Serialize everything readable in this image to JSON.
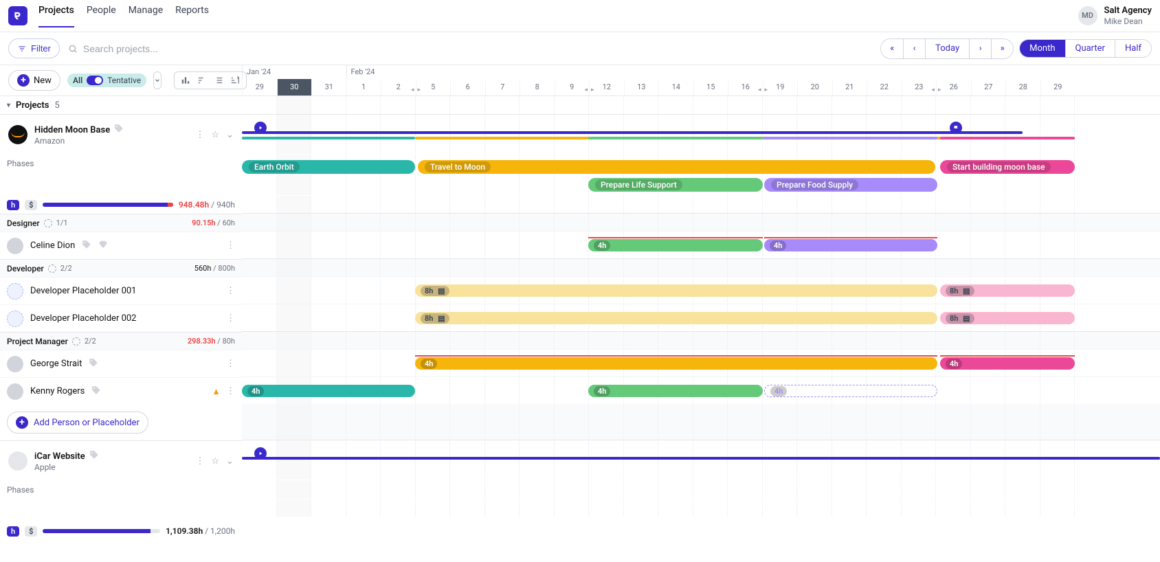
{
  "nav": {
    "items": [
      "Projects",
      "People",
      "Manage",
      "Reports"
    ],
    "activeIndex": 0
  },
  "user": {
    "initials": "MD",
    "agency": "Salt Agency",
    "name": "Mike Dean"
  },
  "toolbar": {
    "filter": "Filter",
    "searchPlaceholder": "Search projects...",
    "today": "Today",
    "views": [
      "Month",
      "Quarter",
      "Half"
    ],
    "activeViewIndex": 0
  },
  "subtoolbar": {
    "new": "New",
    "all": "All",
    "tentative": "Tentative"
  },
  "timeline": {
    "months": [
      {
        "label": "Jan '24",
        "span": 3
      },
      {
        "label": "Feb '24",
        "span": 21
      }
    ],
    "days": [
      "29",
      "30",
      "31",
      "1",
      "2",
      "5",
      "6",
      "7",
      "8",
      "9",
      "12",
      "13",
      "14",
      "15",
      "16",
      "19",
      "20",
      "21",
      "22",
      "23",
      "26",
      "27",
      "28",
      "29"
    ],
    "todayIndex": 1,
    "weekends": [
      4,
      9,
      14,
      19
    ]
  },
  "projectsHeader": {
    "label": "Projects",
    "count": "5"
  },
  "projects": [
    {
      "name": "Hidden Moon Base",
      "client": "Amazon",
      "avatarClass": "amazon",
      "phasesLabel": "Phases",
      "budget": {
        "used": "948.48h",
        "total": "940h",
        "percent": 100,
        "over": true
      },
      "summaries": [
        {
          "start": 0,
          "end": 252,
          "color": "#2ab7a9"
        },
        {
          "start": 252,
          "end": 1212,
          "color": "#f5b50a"
        },
        {
          "start": 504,
          "end": 758,
          "color": "#65c97a"
        },
        {
          "start": 758,
          "end": 1012,
          "color": "#a78bfa"
        },
        {
          "start": 1016,
          "end": 1212,
          "color": "#ec4899"
        }
      ],
      "phases": [
        {
          "row": 0,
          "start": 0,
          "end": 252,
          "color": "#2ab7a9",
          "label": "Earth Orbit"
        },
        {
          "row": 0,
          "start": 256,
          "end": 1009,
          "color": "#f5b50a",
          "label": "Travel to Moon"
        },
        {
          "row": 0,
          "start": 1016,
          "end": 1212,
          "color": "#ec4899",
          "label": "Start building moon base"
        },
        {
          "row": 1,
          "start": 504,
          "end": 758,
          "color": "#65c97a",
          "label": "Prepare Life Support"
        },
        {
          "row": 1,
          "start": 760,
          "end": 1012,
          "color": "#a78bfa",
          "label": "Prepare Food Supply"
        }
      ],
      "roles": [
        {
          "name": "Designer",
          "count": "1/1",
          "budget": {
            "used": "90.15h",
            "total": "60h",
            "over": true
          },
          "people": [
            {
              "name": "Celine Dion",
              "icons": [
                "tag",
                "diamond"
              ],
              "allocs": [
                {
                  "start": 504,
                  "end": 758,
                  "color": "#65c97a",
                  "label": "4h",
                  "overline": true
                },
                {
                  "start": 760,
                  "end": 1012,
                  "color": "#a78bfa",
                  "label": "4h",
                  "overline": true
                }
              ]
            }
          ]
        },
        {
          "name": "Developer",
          "count": "2/2",
          "budget": {
            "used": "560h",
            "total": "800h",
            "over": false
          },
          "people": [
            {
              "name": "Developer Placeholder 001",
              "placeholder": true,
              "allocs": [
                {
                  "start": 252,
                  "end": 1012,
                  "color": "#f9e29c",
                  "label": "8h",
                  "note": true,
                  "textDark": true
                },
                {
                  "start": 1016,
                  "end": 1212,
                  "color": "#f9b6d0",
                  "label": "8h",
                  "note": true,
                  "textDark": true
                }
              ]
            },
            {
              "name": "Developer Placeholder 002",
              "placeholder": true,
              "allocs": [
                {
                  "start": 252,
                  "end": 1012,
                  "color": "#f9e29c",
                  "label": "8h",
                  "note": true,
                  "textDark": true
                },
                {
                  "start": 1016,
                  "end": 1212,
                  "color": "#f9b6d0",
                  "label": "8h",
                  "note": true,
                  "textDark": true
                }
              ]
            }
          ]
        },
        {
          "name": "Project Manager",
          "count": "2/2",
          "budget": {
            "used": "298.33h",
            "total": "80h",
            "over": true
          },
          "people": [
            {
              "name": "George Strait",
              "icons": [
                "tag"
              ],
              "allocs": [
                {
                  "start": 252,
                  "end": 1012,
                  "color": "#f5b50a",
                  "label": "4h",
                  "overline": true
                },
                {
                  "start": 1016,
                  "end": 1212,
                  "color": "#ec4899",
                  "label": "4h",
                  "overline": true
                }
              ]
            },
            {
              "name": "Kenny Rogers",
              "icons": [
                "tag"
              ],
              "warn": true,
              "allocs": [
                {
                  "start": 0,
                  "end": 252,
                  "color": "#2ab7a9",
                  "label": "4h"
                },
                {
                  "start": 504,
                  "end": 758,
                  "color": "#65c97a",
                  "label": "4h"
                },
                {
                  "start": 760,
                  "end": 1012,
                  "color": "#a78bfa",
                  "label": "4h",
                  "dashed": true
                }
              ]
            }
          ]
        }
      ],
      "addPerson": "Add Person or Placeholder"
    },
    {
      "name": "iCar Website",
      "client": "Apple",
      "avatarClass": "apple",
      "avatarGlyph": "",
      "phasesLabel": "Phases",
      "budget": {
        "used": "1,109.38h",
        "total": "1,200h",
        "percent": 92,
        "over": false
      },
      "projLineFull": true
    }
  ]
}
